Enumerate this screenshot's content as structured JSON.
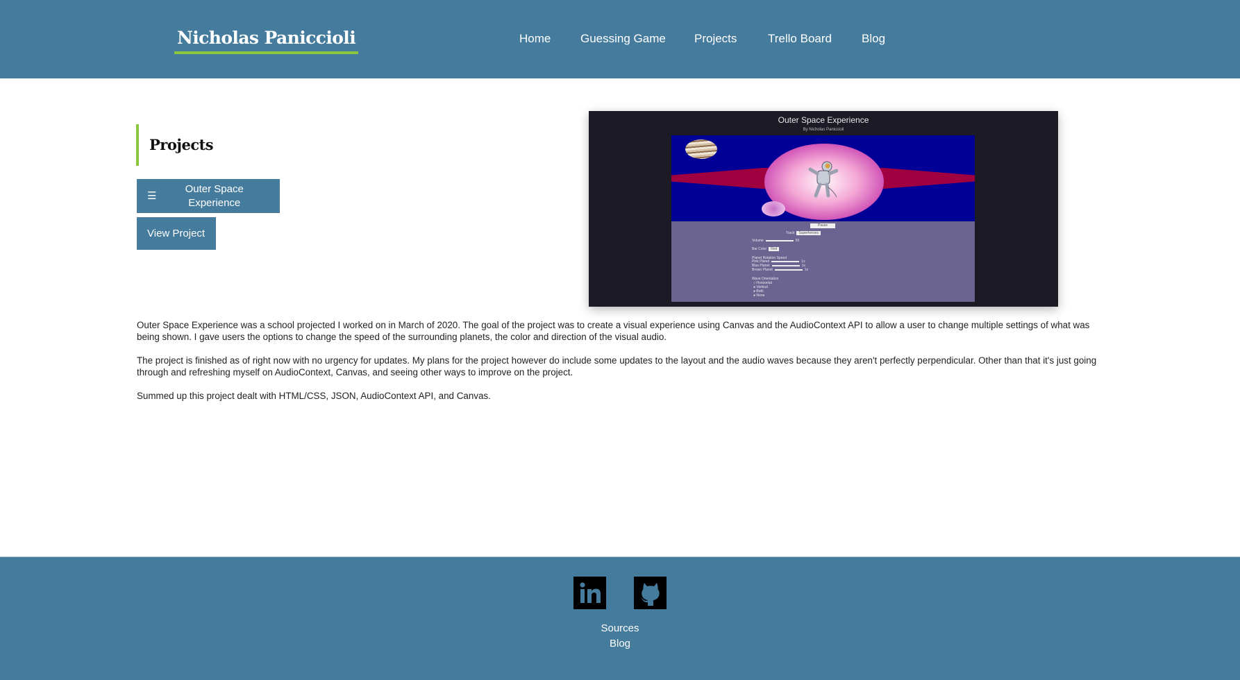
{
  "header": {
    "logo": "Nicholas Paniccioli",
    "nav": [
      {
        "label": "Home"
      },
      {
        "label": "Guessing Game"
      },
      {
        "label": "Projects"
      },
      {
        "label": "Trello Board"
      },
      {
        "label": "Blog"
      }
    ]
  },
  "main": {
    "heading": "Projects",
    "project_menu_icon": "☰",
    "project_button": "Outer Space Experience",
    "view_button": "View Project",
    "preview": {
      "title": "Outer Space Experience",
      "subtitle": "By Nicholas Paniccioli",
      "pause_label": "Pause",
      "track_label": "Track",
      "track_value": "Superheroes",
      "volume_label": "Volume",
      "volume_value": "50",
      "bar_color_label": "Bar Color",
      "bar_color_value": "Red",
      "rotation_label": "Planet Rotation Speed",
      "pink_planet": "Pink Planet",
      "blue_planet": "Blue Planet",
      "brown_planet": "Brown Planet",
      "speed_unit": "1x",
      "orientation_label": "Wave Orientation",
      "orientation_options": [
        "Horizontal",
        "Vertical",
        "Both",
        "None"
      ]
    },
    "paragraphs": [
      "Outer Space Experience was a school projected I worked on in March of 2020. The goal of the project was to create a visual experience using Canvas and the AudioContext API to allow a user to change multiple settings of what was being shown. I gave users the options to change the speed of the surrounding planets, the color and direction of the visual audio.",
      "The project is finished as of right now with no urgency for updates. My plans for the project however do include some updates to the layout and the audio waves because they aren't perfectly perpendicular. Other than that it's just going through and refreshing myself on AudioContext, Canvas, and seeing other ways to improve on the project.",
      "Summed up this project dealt with HTML/CSS, JSON, AudioContext API, and Canvas."
    ]
  },
  "footer": {
    "social": [
      {
        "icon": "linkedin-icon"
      },
      {
        "icon": "github-icon"
      }
    ],
    "links": [
      {
        "label": "Sources"
      },
      {
        "label": "Blog"
      }
    ]
  },
  "colors": {
    "primary": "#457b9d",
    "accent": "#8cc63f"
  }
}
